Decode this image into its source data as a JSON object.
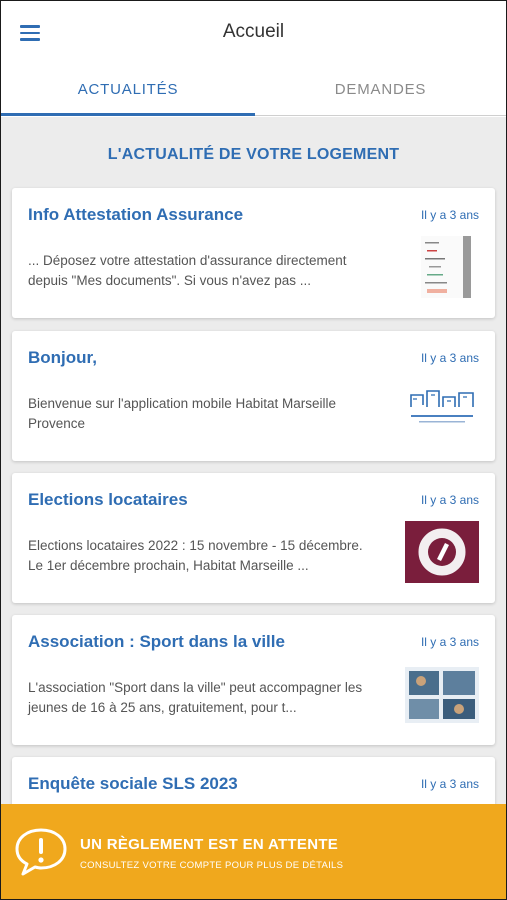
{
  "header": {
    "title": "Accueil"
  },
  "tabs": [
    {
      "label": "ACTUALITÉS",
      "active": true
    },
    {
      "label": "DEMANDES",
      "active": false
    }
  ],
  "section_title": "L'ACTUALITÉ DE VOTRE LOGEMENT",
  "news": [
    {
      "title": "Info Attestation Assurance",
      "time": "Il y a 3 ans",
      "excerpt": "... Déposez votre attestation d'assurance directement depuis \"Mes documents\". Si vous n'avez pas ...",
      "thumb_icon": "document-thumbnail-icon"
    },
    {
      "title": "Bonjour,",
      "time": "Il y a 3 ans",
      "excerpt": "Bienvenue sur l'application mobile Habitat Marseille Provence",
      "thumb_icon": "habitat-logo-icon"
    },
    {
      "title": "Elections locataires",
      "time": "Il y a 3 ans",
      "excerpt": "Elections locataires 2022 : 15 novembre - 15 décembre. Le 1er décembre prochain, Habitat Marseille ...",
      "thumb_icon": "election-badge-icon"
    },
    {
      "title": "Association : Sport dans la ville",
      "time": "Il y a 3 ans",
      "excerpt": "L'association \"Sport dans la ville\" peut accompagner les jeunes de 16 à 25 ans, gratuitement, pour t...",
      "thumb_icon": "flyer-photo-icon"
    },
    {
      "title": "Enquête sociale SLS 2023",
      "time": "Il y a 3 ans",
      "excerpt": "",
      "thumb_icon": ""
    }
  ],
  "banner": {
    "title": "UN RÈGLEMENT EST EN ATTENTE",
    "subtitle": "CONSULTEZ VOTRE COMPTE POUR PLUS DE DÉTAILS",
    "icon": "alert-speech-bubble-icon"
  },
  "colors": {
    "accent": "#2f6db3",
    "banner": "#f0a81d",
    "background": "#ececec"
  }
}
